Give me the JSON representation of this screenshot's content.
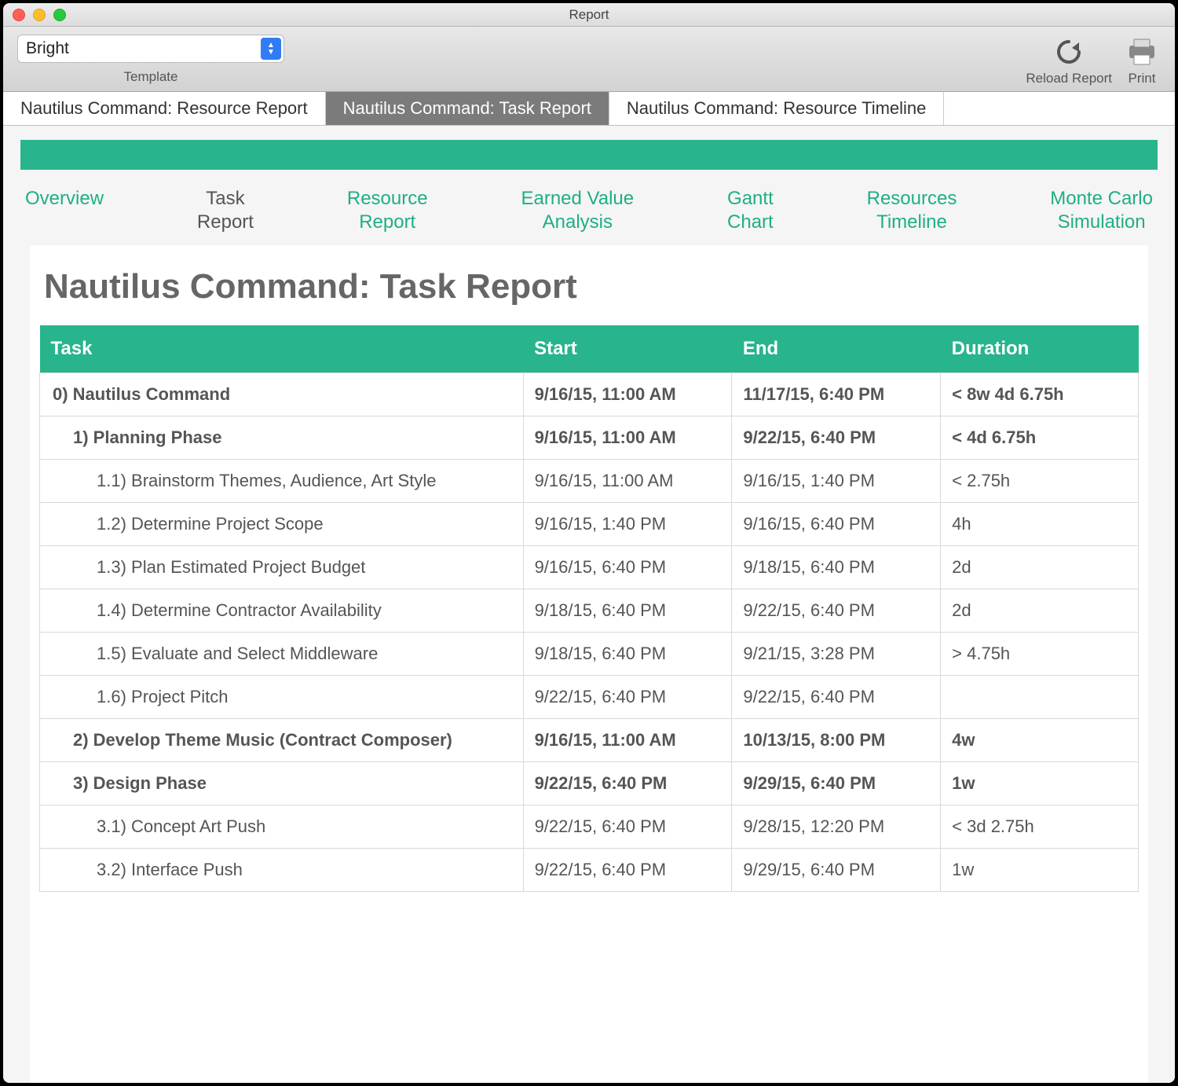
{
  "window": {
    "title": "Report"
  },
  "toolbar": {
    "template_value": "Bright",
    "template_label": "Template",
    "reload_label": "Reload Report",
    "print_label": "Print"
  },
  "window_tabs": [
    {
      "label": "Nautilus Command: Resource Report",
      "active": false
    },
    {
      "label": "Nautilus Command: Task Report",
      "active": true
    },
    {
      "label": "Nautilus Command: Resource Timeline",
      "active": false
    }
  ],
  "subnav": [
    {
      "line1": "Overview",
      "line2": "",
      "active": false
    },
    {
      "line1": "Task",
      "line2": "Report",
      "active": true
    },
    {
      "line1": "Resource",
      "line2": "Report",
      "active": false
    },
    {
      "line1": "Earned Value",
      "line2": "Analysis",
      "active": false
    },
    {
      "line1": "Gantt",
      "line2": "Chart",
      "active": false
    },
    {
      "line1": "Resources",
      "line2": "Timeline",
      "active": false
    },
    {
      "line1": "Monte Carlo",
      "line2": "Simulation",
      "active": false
    }
  ],
  "report": {
    "title": "Nautilus Command: Task Report",
    "columns": {
      "task": "Task",
      "start": "Start",
      "end": "End",
      "duration": "Duration"
    },
    "rows": [
      {
        "level": 0,
        "task": "0) Nautilus Command",
        "start": "9/16/15, 11:00 AM",
        "end": "11/17/15, 6:40 PM",
        "duration": "< 8w 4d 6.75h"
      },
      {
        "level": 1,
        "task": "1) Planning Phase",
        "start": "9/16/15, 11:00 AM",
        "end": "9/22/15, 6:40 PM",
        "duration": "< 4d 6.75h"
      },
      {
        "level": 2,
        "task": "1.1) Brainstorm Themes, Audience, Art Style",
        "start": "9/16/15, 11:00 AM",
        "end": "9/16/15, 1:40 PM",
        "duration": "< 2.75h"
      },
      {
        "level": 2,
        "task": "1.2) Determine Project Scope",
        "start": "9/16/15, 1:40 PM",
        "end": "9/16/15, 6:40 PM",
        "duration": "4h"
      },
      {
        "level": 2,
        "task": "1.3) Plan Estimated Project Budget",
        "start": "9/16/15, 6:40 PM",
        "end": "9/18/15, 6:40 PM",
        "duration": "2d"
      },
      {
        "level": 2,
        "task": "1.4) Determine Contractor Availability",
        "start": "9/18/15, 6:40 PM",
        "end": "9/22/15, 6:40 PM",
        "duration": "2d"
      },
      {
        "level": 2,
        "task": "1.5) Evaluate and Select Middleware",
        "start": "9/18/15, 6:40 PM",
        "end": "9/21/15, 3:28 PM",
        "duration": "> 4.75h"
      },
      {
        "level": 2,
        "task": "1.6) Project Pitch",
        "start": "9/22/15, 6:40 PM",
        "end": "9/22/15, 6:40 PM",
        "duration": ""
      },
      {
        "level": 1,
        "task": "2) Develop Theme Music (Contract Composer)",
        "start": "9/16/15, 11:00 AM",
        "end": "10/13/15, 8:00 PM",
        "duration": "4w"
      },
      {
        "level": 1,
        "task": "3) Design Phase",
        "start": "9/22/15, 6:40 PM",
        "end": "9/29/15, 6:40 PM",
        "duration": "1w"
      },
      {
        "level": 2,
        "task": "3.1) Concept Art Push",
        "start": "9/22/15, 6:40 PM",
        "end": "9/28/15, 12:20 PM",
        "duration": "< 3d 2.75h"
      },
      {
        "level": 2,
        "task": "3.2) Interface Push",
        "start": "9/22/15, 6:40 PM",
        "end": "9/29/15, 6:40 PM",
        "duration": "1w"
      }
    ]
  }
}
